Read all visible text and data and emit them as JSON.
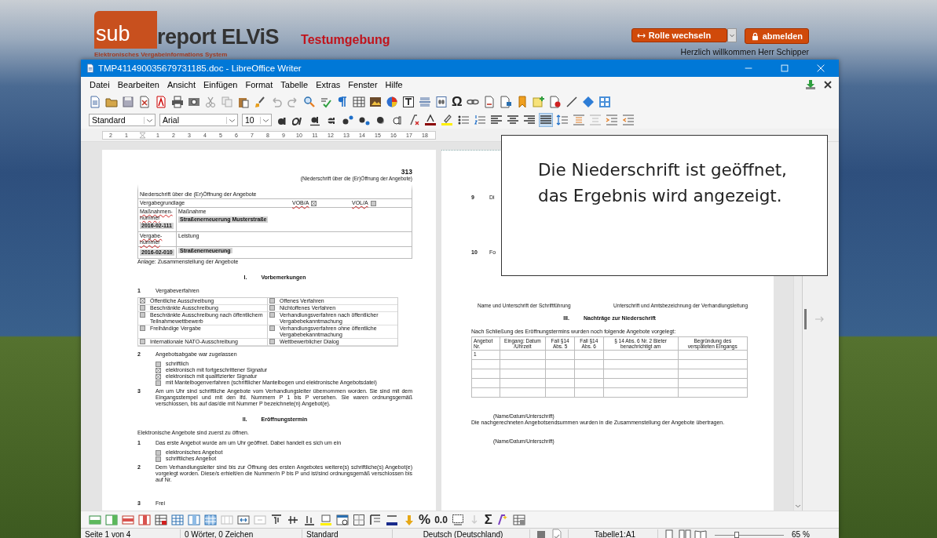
{
  "portal": {
    "logo_sub": "sub",
    "logo_rest": "report ELViS",
    "logo_subtitle": "Elektronisches Vergabeinformations System",
    "environment": "Testumgebung",
    "role_button": "Rolle wechseln",
    "logout_button": "abmelden",
    "welcome": "Herzlich willkommen Herr Schipper"
  },
  "window": {
    "title": "TMP411490035679731185.doc - LibreOffice Writer"
  },
  "menu": [
    "Datei",
    "Bearbeiten",
    "Ansicht",
    "Einfügen",
    "Format",
    "Tabelle",
    "Extras",
    "Fenster",
    "Hilfe"
  ],
  "standard_bar": {
    "special_character_glyph": "Ω"
  },
  "format_bar": {
    "style": "Standard",
    "font": "Arial",
    "size": "10",
    "justify_on": true
  },
  "ruler": {
    "labels": [
      "2",
      "1",
      "1",
      "2",
      "3",
      "4",
      "5",
      "6",
      "7",
      "8",
      "9",
      "10",
      "11",
      "12",
      "13",
      "14",
      "15",
      "16",
      "17",
      "18"
    ]
  },
  "left_page": {
    "page_number": "313",
    "running_head": "(Niederschrift über die (Er)Öffnung der Angebote)",
    "form": {
      "title": "Niederschrift über die (Er)Öffnung der Angebote",
      "basis_label": "Vergabegrundlage",
      "bases": [
        {
          "label": "VOB/A",
          "checked": true
        },
        {
          "label": "VOL/A",
          "checked": false
        }
      ],
      "measure_no_label": "Maßnahmen-nummer",
      "measure_label": "Maßnahme",
      "measure_value": "Straßenerneuerung Musterstraße",
      "measure_no": "2016-02-111",
      "award_no_label": "Vergabe-nummer",
      "service_label": "Leistung",
      "award_no": "2016-02-010",
      "service_value": "Straßenerneuerung"
    },
    "annex": "Anlage: Zusammenstellung der Angebote",
    "section_1": {
      "numeral": "I.",
      "title": "Vorbemerkungen"
    },
    "item_1": {
      "number": "1",
      "title": "Vergabeverfahren",
      "option_rows": [
        [
          {
            "label": "Öffentliche Ausschreibung",
            "checked": true
          },
          {
            "label": "Offenes Verfahren",
            "checked": false
          }
        ],
        [
          {
            "label": "Beschränkte Ausschreibung",
            "checked": false
          },
          {
            "label": "Nichtoffenes Verfahren",
            "checked": false
          }
        ],
        [
          {
            "label": "Beschränkte Ausschreibung nach öffentlichem Teilnahmewettbewerb",
            "checked": false
          },
          {
            "label": "Verhandlungsverfahren nach öffentlicher Vergabebekanntmachung",
            "checked": false
          }
        ],
        [
          {
            "label": "Freihändige Vergabe",
            "checked": false
          },
          {
            "label": "Verhandlungsverfahren ohne öffentliche Vergabebekanntmachung",
            "checked": false
          }
        ],
        [
          {
            "label": "Internationale NATO-Ausschreibung",
            "checked": false
          },
          {
            "label": "Wettbewerblicher Dialog",
            "checked": false
          }
        ]
      ]
    },
    "item_2": {
      "number": "2",
      "title": "Angebotsabgabe war zugelassen",
      "options": [
        {
          "label": "schriftlich",
          "checked": false
        },
        {
          "label": "elektronisch mit fortgeschrittener Signatur",
          "checked": true
        },
        {
          "label": "elektronisch mit qualifizierter Signatur",
          "checked": true
        },
        {
          "label": "mit Mantelbogenverfahren (schriftlicher Mantelbogen und elektronische Angebotsdatei)",
          "checked": false
        }
      ]
    },
    "item_3": {
      "number": "3",
      "text": "Am um Uhr sind schriftliche Angebote vom Verhandlungsleiter übernommen worden. Sie sind mit dem Eingangsstempel und mit den lfd. Nummern P 1 bis P versehen. Sie waren ordnungsgemäß verschlossen, bis auf das/die mit Nummer P bezeichnete(n) Angebot(e)."
    },
    "section_2": {
      "numeral": "II.",
      "title": "Eröffnungstermin"
    },
    "intro": "Elektronische Angebote sind zuerst zu öffnen.",
    "opening_1": {
      "number": "1",
      "text": "Das erste Angebot wurde am um Uhr geöffnet. Dabei handelt es sich um ein",
      "options": [
        {
          "label": "elektronisches Angebot",
          "checked": false
        },
        {
          "label": "schriftliches Angebot",
          "checked": false
        }
      ]
    },
    "opening_2": {
      "number": "2",
      "text": "Dem Verhandlungsleiter sind bis zur Öffnung des ersten Angebotes weitere(s) schriftliche(s) Angebot(e) vorgelegt worden. Diese/s erhielt/en die Nummer/n P bis P und ist/sind ordnungsgemäß verschlossen bis auf Nr."
    },
    "opening_3": {
      "number": "3",
      "text": "Frei"
    }
  },
  "right_page": {
    "item_9": {
      "number": "9",
      "text": "Di"
    },
    "item_10": {
      "number": "10",
      "text": "Fo"
    },
    "signatures": [
      "Name und Unterschrift der Schriftführung",
      "Unterschrift und Amtsbezeichnung der Verhandlungsleitung"
    ],
    "section_3": {
      "numeral": "III.",
      "title": "Nachträge zur Niederschrift"
    },
    "intro": "Nach Schließung des Eröffnungstermins wurden noch folgende Angebote vorgelegt:",
    "late_table": {
      "columns": [
        "Angebot Nr.",
        "Eingang: Datum /Uhrzeit",
        "Fall §14 Abs. 5",
        "Fall §14 Abs. 6",
        "§ 14 Abs. 6 Nr. 2 Bieter benachrichtigt am",
        "Begründung des verspäteten Eingangs"
      ],
      "rows": [
        {
          "offer_no": "1"
        },
        {},
        {},
        {},
        {}
      ]
    },
    "signature_1": "(Name/Datum/Unterschrift)",
    "transfer_note": "Die nachgerechneten Angebotsendsummen wurden in die Zusammenstellung der Angebote übertragen.",
    "signature_2": "(Name/Datum/Unterschrift)"
  },
  "notice": {
    "lines": [
      "Die Niederschrift ist geöffnet,",
      "das Ergebnis wird angezeigt."
    ]
  },
  "table_bar": {
    "percent_glyph": "%",
    "decimal_glyph": "0.0",
    "sum_glyph": "Σ"
  },
  "status_bar": {
    "page": "Seite 1 von 4",
    "words": "0 Wörter, 0 Zeichen",
    "page_style": "Standard",
    "language": "Deutsch (Deutschland)",
    "cell": "Tabelle1:A1",
    "zoom": {
      "level": 0.32,
      "reading": "65 %"
    }
  }
}
